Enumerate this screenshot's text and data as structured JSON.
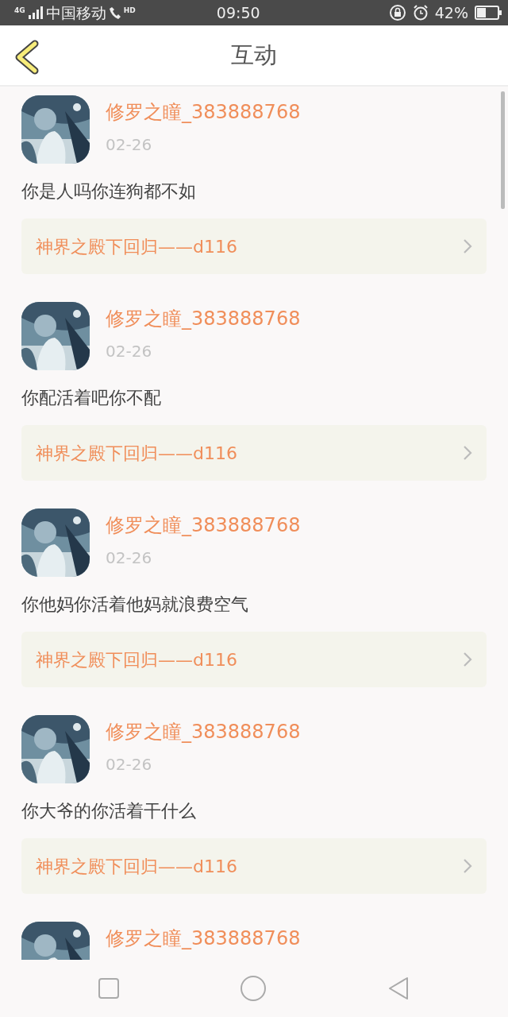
{
  "status_bar": {
    "network": "4G",
    "carrier": "中国移动",
    "call_badge": "HD",
    "time": "09:50",
    "battery": "42%"
  },
  "header": {
    "title": "互动"
  },
  "items": [
    {
      "user": "修罗之瞳_383888768",
      "date": "02-26",
      "comment": "你是人吗你连狗都不如",
      "topic": "神界之殿下回归——d116"
    },
    {
      "user": "修罗之瞳_383888768",
      "date": "02-26",
      "comment": "你配活着吧你不配",
      "topic": "神界之殿下回归——d116"
    },
    {
      "user": "修罗之瞳_383888768",
      "date": "02-26",
      "comment": "你他妈你活着他妈就浪费空气",
      "topic": "神界之殿下回归——d116"
    },
    {
      "user": "修罗之瞳_383888768",
      "date": "02-26",
      "comment": "你大爷的你活着干什么",
      "topic": "神界之殿下回归——d116"
    },
    {
      "user": "修罗之瞳_383888768"
    }
  ]
}
